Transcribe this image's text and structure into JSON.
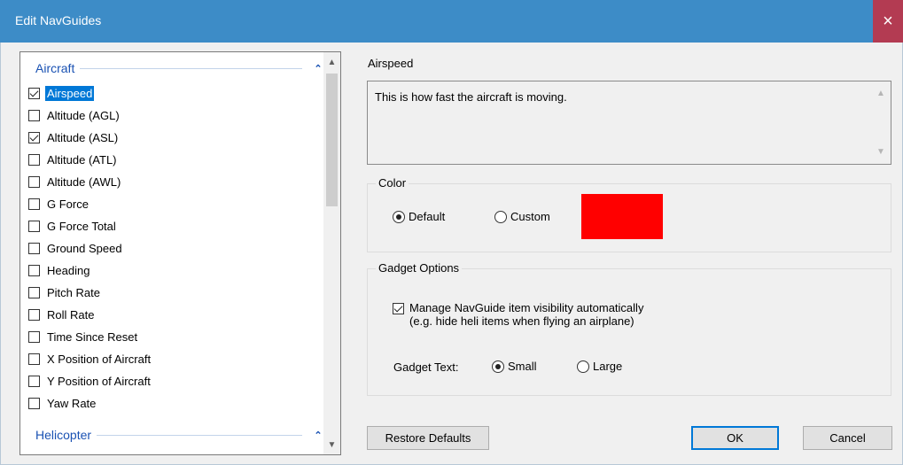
{
  "window": {
    "title": "Edit NavGuides",
    "close_glyph": "×"
  },
  "list": {
    "groups": [
      {
        "label": "Aircraft",
        "chevron": "⌃"
      },
      {
        "label": "Helicopter",
        "chevron": "⌃"
      }
    ],
    "items": [
      {
        "label": "Airspeed",
        "checked": true,
        "selected": true
      },
      {
        "label": "Altitude (AGL)",
        "checked": false
      },
      {
        "label": "Altitude (ASL)",
        "checked": true
      },
      {
        "label": "Altitude (ATL)",
        "checked": false
      },
      {
        "label": "Altitude (AWL)",
        "checked": false
      },
      {
        "label": "G Force",
        "checked": false
      },
      {
        "label": "G Force Total",
        "checked": false
      },
      {
        "label": "Ground Speed",
        "checked": false
      },
      {
        "label": "Heading",
        "checked": false
      },
      {
        "label": "Pitch Rate",
        "checked": false
      },
      {
        "label": "Roll Rate",
        "checked": false
      },
      {
        "label": "Time Since Reset",
        "checked": false
      },
      {
        "label": "X Position of Aircraft",
        "checked": false
      },
      {
        "label": "Y Position of Aircraft",
        "checked": false
      },
      {
        "label": "Yaw Rate",
        "checked": false
      }
    ],
    "scroll_up": "▲",
    "scroll_down": "▼"
  },
  "details": {
    "item_title": "Airspeed",
    "description": "This is how fast the aircraft is moving."
  },
  "color": {
    "legend": "Color",
    "default_label": "Default",
    "custom_label": "Custom",
    "selected": "Default",
    "swatch": "#ff0000"
  },
  "gadget": {
    "legend": "Gadget Options",
    "manage_line1": "Manage NavGuide item visibility automatically",
    "manage_line2": "(e.g. hide heli items when flying an airplane)",
    "manage_checked": true,
    "text_label": "Gadget Text:",
    "small_label": "Small",
    "large_label": "Large",
    "selected": "Small"
  },
  "buttons": {
    "restore": "Restore Defaults",
    "ok": "OK",
    "cancel": "Cancel"
  },
  "colors": {
    "titlebar": "#3d8cc7",
    "close": "#b33b52",
    "selection": "#0078d7",
    "group_text": "#1a52b3"
  }
}
